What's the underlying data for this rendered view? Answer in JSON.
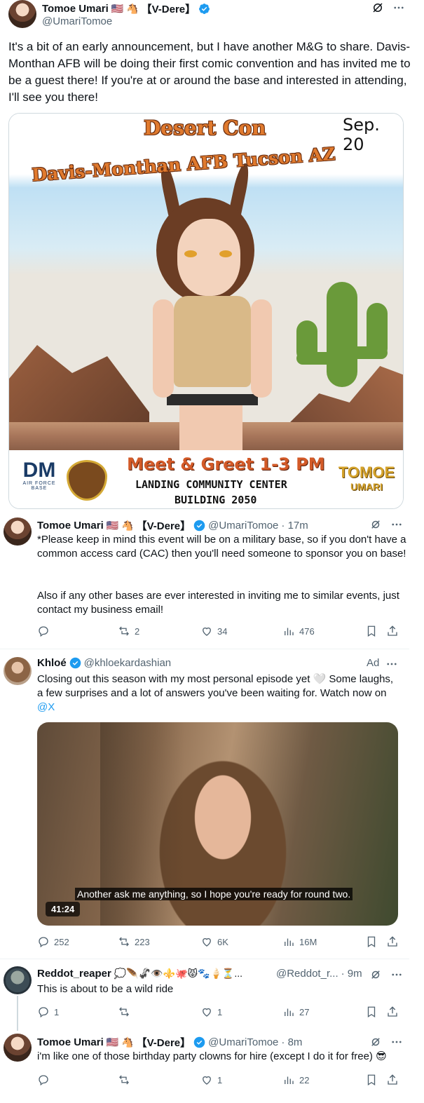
{
  "main_tweet": {
    "author_name": "Tomoe Umari",
    "author_tag": "【V-Dere】",
    "handle": "@UmariTomoe",
    "text": "It's a bit of an early announcement, but I have another M&G to share. Davis-Monthan AFB will be doing their first comic convention and has invited me to be a guest there! If you're at or around the base and interested in attending, I'll see you there!",
    "image": {
      "date": "Sep. 20",
      "title_line1": "Desert Con",
      "title_line2": "Davis-Monthan AFB Tucson AZ",
      "meet": "Meet & Greet 1-3 PM",
      "location_line1": "LANDING COMMUNITY CENTER",
      "location_line2": "BUILDING 2050",
      "logo_dm": "DM",
      "logo_dm_sub": "AIR FORCE BASE",
      "logo_tomoe_line1": "TOMOE",
      "logo_tomoe_line2": "UMARI"
    }
  },
  "reply_1": {
    "author_name": "Tomoe Umari",
    "author_tag": "【V-Dere】",
    "handle": "@UmariTomoe",
    "time": "· 17m",
    "paragraph_1": "*Please keep in mind this event will be on a military base, so if you don't have a common access card (CAC) then you'll need someone to sponsor you on base!",
    "paragraph_2": "Also if any other bases are ever interested in inviting me to similar events, just contact my business email!",
    "actions": {
      "replies": "",
      "reposts": "2",
      "likes": "34",
      "views": "476"
    }
  },
  "ad_tweet": {
    "author_name": "Khloé",
    "handle": "@khloekardashian",
    "ad_label": "Ad",
    "text_before_link": "Closing out this season with my most personal episode yet 🤍 Some laughs, a few surprises and a lot of answers you've been waiting for. Watch now on ",
    "link": "@X",
    "video": {
      "caption": "Another ask me anything, so I hope you're ready for round two.",
      "duration": "41:24"
    },
    "actions": {
      "replies": "252",
      "reposts": "223",
      "likes": "6K",
      "views": "16M"
    }
  },
  "reddot_tweet": {
    "author_name": "Reddot_reaper",
    "emojis": "💭🪶🦨👁️⚜️🐙😾🐾🍦⏳...",
    "handle": "@Reddot_r...",
    "time": "· 9m",
    "text": "This is about to be a wild ride",
    "actions": {
      "replies": "1",
      "reposts": "",
      "likes": "1",
      "views": "27"
    }
  },
  "last_tweet": {
    "author_name": "Tomoe Umari",
    "author_tag": "【V-Dere】",
    "handle": "@UmariTomoe",
    "time": "· 8m",
    "text": "i'm like one of those birthday party clowns for hire (except I do it for free) 😎",
    "actions": {
      "replies": "",
      "reposts": "",
      "likes": "1",
      "views": "22"
    }
  },
  "colors": {
    "accent": "#1d9bf0",
    "secondary_text": "#536471",
    "divider": "#eff3f4"
  }
}
